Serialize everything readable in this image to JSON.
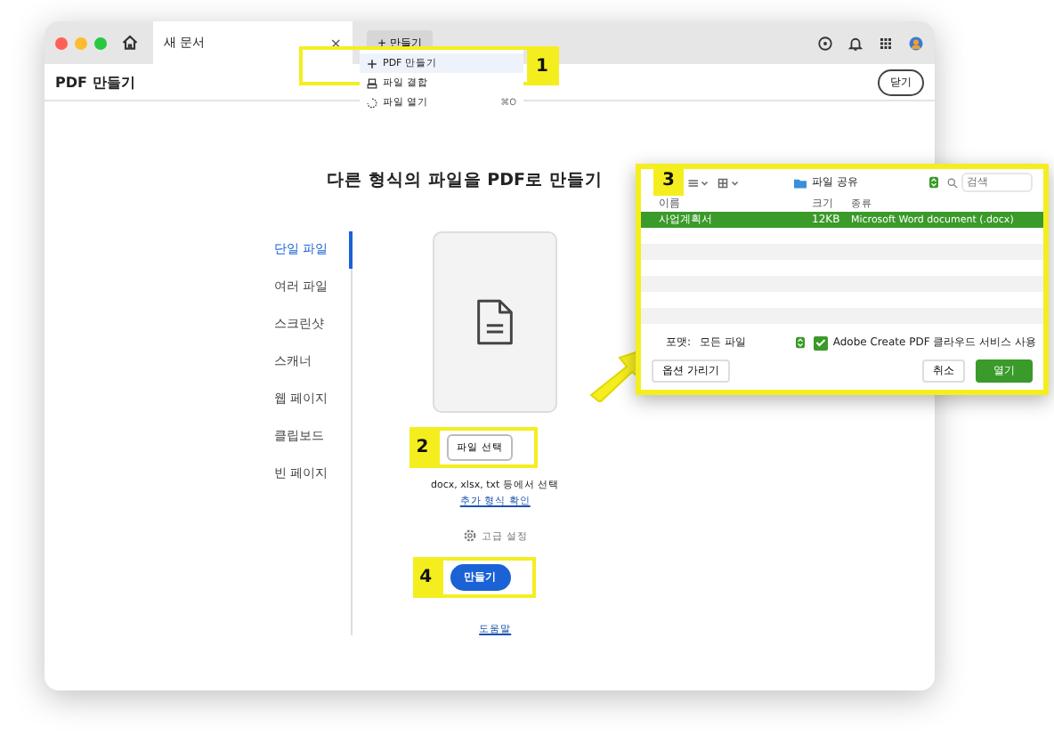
{
  "tabs": [
    {
      "label": "새 문서",
      "close": "×",
      "selected": true
    }
  ],
  "new_button": {
    "icon": "+",
    "label": "만들기"
  },
  "menu": [
    {
      "kind": "create",
      "label": "PDF 만들기",
      "selected": true
    },
    {
      "kind": "combine",
      "label": "파일 결합",
      "selected": false
    },
    {
      "kind": "open",
      "label": "파일 열기",
      "shortcut": "⌘O",
      "selected": false
    }
  ],
  "header": {
    "title": "PDF 만들기",
    "close_button": "닫기"
  },
  "heading": "다른 형식의 파일을 PDF로 만들기",
  "sidebar": {
    "items": [
      {
        "label": "단일 파일",
        "selected": true
      },
      {
        "label": "여러 파일",
        "selected": false
      },
      {
        "label": "스크린샷",
        "selected": false
      },
      {
        "label": "스캐너",
        "selected": false
      },
      {
        "label": "웹 페이지",
        "selected": false
      },
      {
        "label": "클립보드",
        "selected": false
      },
      {
        "label": "빈 페이지",
        "selected": false
      }
    ]
  },
  "panel": {
    "select_button": "파일 선택",
    "hint": "docx, xlsx, txt 등에서 선택",
    "formats_link": "추가 형식 확인",
    "advanced": "고급 설정",
    "create_button": "만들기",
    "help_link": "도움말"
  },
  "dialog": {
    "location": "파일 공유",
    "search": {
      "placeholder": "검색"
    },
    "columns": [
      "이름",
      "크기",
      "종류"
    ],
    "rows": [
      {
        "name": "사업계획서",
        "size": "12KB",
        "kind": "Microsoft Word document (.docx)",
        "selected": true
      }
    ],
    "format_label": "포맷:",
    "format_value": "모든 파일",
    "checkbox": {
      "label": "Adobe Create PDF 클라우드 서비스 사용",
      "checked": true
    },
    "options_button": "옵션 가리기",
    "cancel_button": "취소",
    "open_button": "열기"
  },
  "callouts": [
    "1",
    "2",
    "3",
    "4"
  ]
}
